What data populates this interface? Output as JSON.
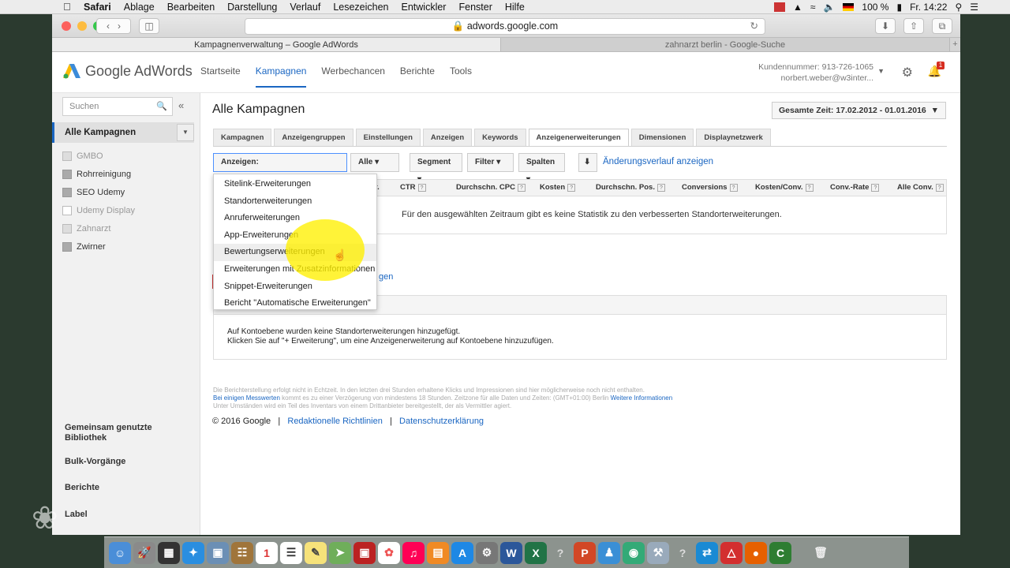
{
  "menubar": {
    "app": "Safari",
    "items": [
      "Ablage",
      "Bearbeiten",
      "Darstellung",
      "Verlauf",
      "Lesezeichen",
      "Entwickler",
      "Fenster",
      "Hilfe"
    ],
    "battery": "100 %",
    "clock": "Fr. 14:22"
  },
  "browser": {
    "url": "adwords.google.com",
    "tabs": [
      "Kampagnenverwaltung – Google AdWords",
      "zahnarzt berlin - Google-Suche"
    ]
  },
  "header": {
    "brand": "Google AdWords",
    "nav": [
      "Startseite",
      "Kampagnen",
      "Werbechancen",
      "Berichte",
      "Tools"
    ],
    "customer_number": "Kundennummer: 913-726-1065",
    "email": "norbert.weber@w3inter...",
    "notification_count": "1"
  },
  "sidebar": {
    "search_placeholder": "Suchen",
    "all_campaigns": "Alle Kampagnen",
    "campaigns": [
      {
        "label": "GMBO",
        "paused": true
      },
      {
        "label": "Rohrreinigung",
        "paused": false
      },
      {
        "label": "SEO Udemy",
        "paused": false
      },
      {
        "label": "Udemy Display",
        "paused": true
      },
      {
        "label": "Zahnarzt",
        "paused": true
      },
      {
        "label": "Zwirner",
        "paused": false
      }
    ],
    "links": [
      "Gemeinsam genutzte Bibliothek",
      "Bulk-Vorgänge",
      "Berichte",
      "Label"
    ]
  },
  "main": {
    "title": "Alle Kampagnen",
    "date_range": "Gesamte Zeit: 17.02.2012 - 01.01.2016",
    "tabs": [
      "Kampagnen",
      "Anzeigengruppen",
      "Einstellungen",
      "Anzeigen",
      "Keywords",
      "Anzeigenerweiterungen",
      "Dimensionen",
      "Displaynetzwerk"
    ],
    "active_tab": "Anzeigenerweiterungen",
    "toolbar": {
      "view": "Anzeigen: Standorterweiterungen",
      "all": "Alle",
      "segment": "Segment",
      "filter": "Filter",
      "columns": "Spalten",
      "history": "Änderungsverlauf anzeigen"
    },
    "columns": [
      "r.",
      "CTR",
      "Durchschn. CPC",
      "Kosten",
      "Durchschn. Pos.",
      "Conversions",
      "Kosten/Conv.",
      "Conv.-Rate",
      "Alle Conv."
    ],
    "no_stats": "Für den ausgewählten Zeitraum gibt es keine Statistik zu den verbesserten Standorterweiterungen.",
    "partial_link": "gen",
    "account_msg_1": "Auf Kontoebene wurden keine Standorterweiterungen hinzugefügt.",
    "account_msg_2": "Klicken Sie auf \"+ Erweiterung\", um eine Anzeigenerweiterung auf Kontoebene hinzuzufügen.",
    "footnote_1": "Die Berichterstellung erfolgt nicht in Echtzeit. In den letzten drei Stunden erhaltene Klicks und Impressionen sind hier möglicherweise noch nicht enthalten.",
    "footnote_2a": "Bei einigen Messwerten",
    "footnote_2b": " kommt es zu einer Verzögerung von mindestens 18 Stunden. Zeitzone für alle Daten und Zeiten: (GMT+01:00) Berlin ",
    "footnote_2c": "Weitere Informationen",
    "footnote_3": "Unter Umständen wird ein Teil des Inventars von einem Drittanbieter bereitgestellt, der als Vermittler agiert.",
    "copyright": "© 2016 Google",
    "link1": "Redaktionelle Richtlinien",
    "link2": "Datenschutzerklärung"
  },
  "dropdown": {
    "items": [
      "Sitelink-Erweiterungen",
      "Standorterweiterungen",
      "Anruferweiterungen",
      "App-Erweiterungen",
      "Bewertungserweiterungen",
      "Erweiterungen mit Zusatzinformationen",
      "Snippet-Erweiterungen",
      "Bericht \"Automatische Erweiterungen\""
    ],
    "hovered": "Bewertungserweiterungen"
  }
}
